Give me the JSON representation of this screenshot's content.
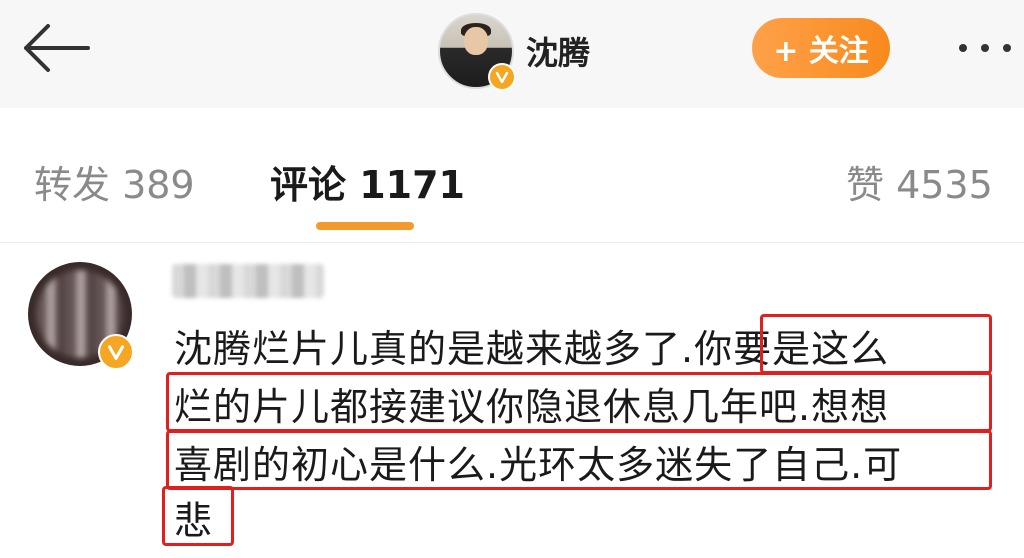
{
  "header": {
    "back_icon": "arrow-left-icon",
    "user_name": "沈腾",
    "verified_icon": "verified-v-icon",
    "follow_label": "+ 关注",
    "more_icon": "more-dots-icon",
    "accent_color": "#f88a1c"
  },
  "tabs": [
    {
      "label": "转发 389",
      "active": false
    },
    {
      "label": "评论 1171",
      "active": true
    },
    {
      "label": "赞 4535",
      "active": false
    }
  ],
  "comment": {
    "lines": [
      "沈腾烂片儿真的是越来越多了.你要是这么",
      "烂的片儿都接建议你隐退休息几年吧.想想",
      "喜剧的初心是什么.光环太多迷失了自己.可",
      "悲"
    ],
    "highlight_color": "#e0201f"
  }
}
